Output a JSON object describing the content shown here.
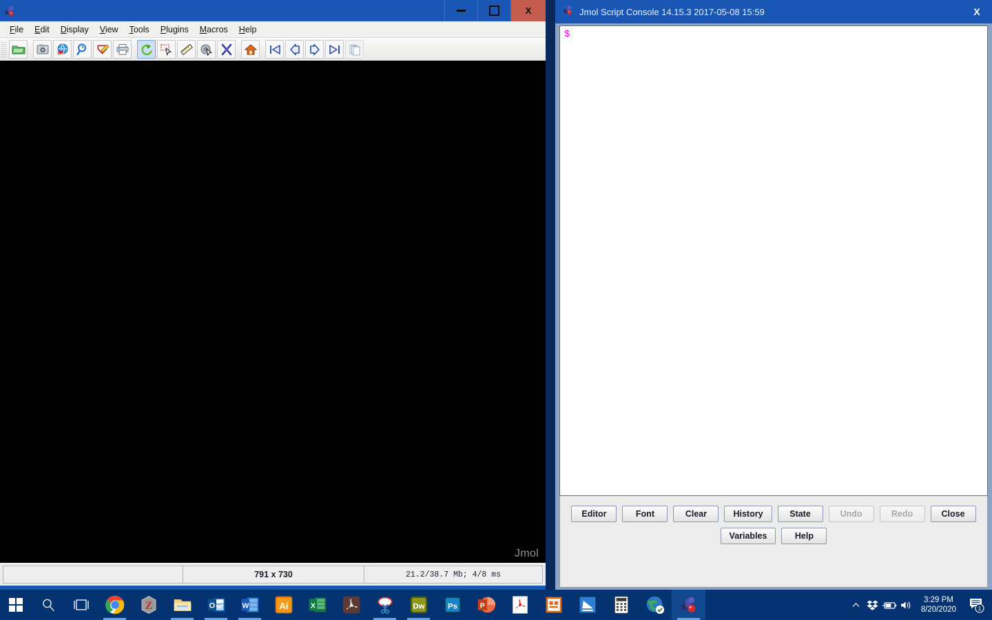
{
  "jmol_window": {
    "title": "",
    "icon": "jmol-logo-icon",
    "controls": {
      "minimize": "minimize-icon",
      "maximize": "maximize-icon",
      "close": "X"
    },
    "menubar": [
      {
        "mnemonic": "F",
        "rest": "ile"
      },
      {
        "mnemonic": "E",
        "rest": "dit"
      },
      {
        "mnemonic": "D",
        "rest": "isplay"
      },
      {
        "mnemonic": "V",
        "rest": "iew"
      },
      {
        "mnemonic": "T",
        "rest": "ools"
      },
      {
        "mnemonic": "P",
        "rest": "lugins"
      },
      {
        "mnemonic": "M",
        "rest": "acros"
      },
      {
        "mnemonic": "H",
        "rest": "elp"
      }
    ],
    "toolbar": [
      {
        "name": "open-file-icon",
        "group": 0,
        "selected": false
      },
      {
        "name": "save-image-icon",
        "group": 1,
        "selected": false
      },
      {
        "name": "export-web-icon",
        "group": 1,
        "selected": false
      },
      {
        "name": "search-pdb-icon",
        "group": 1,
        "selected": false
      },
      {
        "name": "export-write-icon",
        "group": 1,
        "selected": false
      },
      {
        "name": "print-icon",
        "group": 1,
        "selected": false
      },
      {
        "name": "rotate-molecule-icon",
        "group": 2,
        "selected": true
      },
      {
        "name": "rubberband-select-icon",
        "group": 2,
        "selected": false
      },
      {
        "name": "measure-distance-icon",
        "group": 2,
        "selected": false
      },
      {
        "name": "pick-atom-icon",
        "group": 2,
        "selected": false
      },
      {
        "name": "modify-bond-icon",
        "group": 2,
        "selected": false
      },
      {
        "name": "home-reset-icon",
        "group": 3,
        "selected": false
      },
      {
        "name": "first-frame-icon",
        "group": 4,
        "selected": false
      },
      {
        "name": "previous-frame-icon",
        "group": 4,
        "selected": false
      },
      {
        "name": "next-frame-icon",
        "group": 4,
        "selected": false
      },
      {
        "name": "last-frame-icon",
        "group": 4,
        "selected": false
      },
      {
        "name": "copy-frames-icon",
        "group": 4,
        "selected": false,
        "disabled": true
      }
    ],
    "canvas": {
      "background_color": "#000000",
      "watermark": "Jmol"
    },
    "statusbar": {
      "message": "",
      "dimensions": "791 x 730",
      "memory": "21.2/38.7 Mb;   4/8 ms"
    }
  },
  "console_window": {
    "icon": "jmol-logo-icon",
    "title": "Jmol Script Console 14.15.3  2017-05-08 15:59",
    "close_label": "X",
    "output": {
      "prompt": "$",
      "prompt_color": "#ff00ff",
      "lines": []
    },
    "buttons_row1": [
      {
        "label": "Editor",
        "name": "editor-button",
        "disabled": false
      },
      {
        "label": "Font",
        "name": "font-button",
        "disabled": false
      },
      {
        "label": "Clear",
        "name": "clear-button",
        "disabled": false
      },
      {
        "label": "History",
        "name": "history-button",
        "disabled": false
      },
      {
        "label": "State",
        "name": "state-button",
        "disabled": false
      },
      {
        "label": "Undo",
        "name": "undo-button",
        "disabled": true
      },
      {
        "label": "Redo",
        "name": "redo-button",
        "disabled": true
      },
      {
        "label": "Close",
        "name": "close-button",
        "disabled": false
      }
    ],
    "buttons_row2": [
      {
        "label": "Variables",
        "name": "variables-button",
        "disabled": false
      },
      {
        "label": "Help",
        "name": "help-button",
        "disabled": false
      }
    ]
  },
  "taskbar": {
    "background_color": "#053270",
    "start": "windows-start-icon",
    "search": "search-icon",
    "taskview": "task-view-icon",
    "apps": [
      {
        "name": "taskbar-app-chrome",
        "icon": "google-chrome-icon",
        "running": true,
        "active": false
      },
      {
        "name": "taskbar-app-zotero",
        "icon": "zotero-icon",
        "running": false,
        "active": false
      },
      {
        "name": "taskbar-app-file-explorer",
        "icon": "file-explorer-icon",
        "running": true,
        "active": false
      },
      {
        "name": "taskbar-app-outlook",
        "icon": "outlook-icon",
        "running": true,
        "active": false
      },
      {
        "name": "taskbar-app-word",
        "icon": "word-icon",
        "running": true,
        "active": false
      },
      {
        "name": "taskbar-app-illustrator",
        "icon": "illustrator-icon",
        "running": false,
        "active": false
      },
      {
        "name": "taskbar-app-excel",
        "icon": "excel-icon",
        "running": false,
        "active": false
      },
      {
        "name": "taskbar-app-acrobat-pro",
        "icon": "acrobat-pro-icon",
        "running": false,
        "active": false
      },
      {
        "name": "taskbar-app-snipping-tool",
        "icon": "snipping-tool-icon",
        "running": true,
        "active": false
      },
      {
        "name": "taskbar-app-dreamweaver",
        "icon": "dreamweaver-icon",
        "running": true,
        "active": false
      },
      {
        "name": "taskbar-app-photoshop",
        "icon": "photoshop-icon",
        "running": false,
        "active": false
      },
      {
        "name": "taskbar-app-powerpoint",
        "icon": "powerpoint-icon",
        "running": false,
        "active": false
      },
      {
        "name": "taskbar-app-adobe-reader",
        "icon": "adobe-reader-icon",
        "running": false,
        "active": false
      },
      {
        "name": "taskbar-app-publisher",
        "icon": "publisher-icon",
        "running": false,
        "active": false
      },
      {
        "name": "taskbar-app-scanner",
        "icon": "scanner-icon",
        "running": false,
        "active": false
      },
      {
        "name": "taskbar-app-calculator",
        "icon": "calculator-icon",
        "running": false,
        "active": false
      },
      {
        "name": "taskbar-app-browser",
        "icon": "globe-browser-icon",
        "running": false,
        "active": false
      },
      {
        "name": "taskbar-app-jmol",
        "icon": "jmol-logo-icon",
        "running": true,
        "active": true
      }
    ],
    "tray": {
      "chevron": "chevron-up-icon",
      "dropbox": "dropbox-icon",
      "battery": "battery-icon",
      "volume": "volume-icon",
      "time": "3:29 PM",
      "date": "8/20/2020",
      "notifications": "notification-icon",
      "notification_count": "1"
    }
  }
}
